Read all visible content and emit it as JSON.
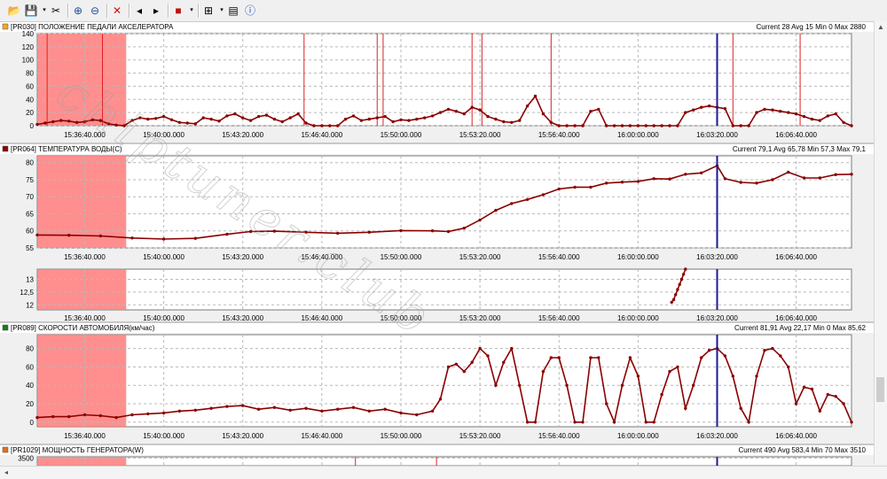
{
  "toolbar": {
    "buttons": [
      {
        "name": "open-icon",
        "glyph": "📂"
      },
      {
        "name": "save-icon",
        "glyph": "💾"
      },
      {
        "name": "save-dropdown-icon",
        "glyph": "▾",
        "small": true
      },
      {
        "name": "cut-icon",
        "glyph": "✂"
      },
      {
        "sep": true
      },
      {
        "name": "zoom-in-icon",
        "glyph": "⊕"
      },
      {
        "name": "zoom-out-icon",
        "glyph": "⊖"
      },
      {
        "sep": true
      },
      {
        "name": "delete-icon",
        "glyph": "✕"
      },
      {
        "sep": true
      },
      {
        "name": "previous-icon",
        "glyph": "◂"
      },
      {
        "name": "next-icon",
        "glyph": "▸"
      },
      {
        "sep": true
      },
      {
        "name": "color-icon",
        "glyph": "■"
      },
      {
        "name": "color-dropdown-icon",
        "glyph": "▾",
        "small": true
      },
      {
        "sep": true
      },
      {
        "name": "grid-icon",
        "glyph": "⊞"
      },
      {
        "name": "grid-dropdown-icon",
        "glyph": "▾",
        "small": true
      },
      {
        "name": "table-icon",
        "glyph": "▤"
      },
      {
        "name": "info-icon",
        "glyph": "ⓘ"
      }
    ]
  },
  "colors": {
    "trace": "#8b0000",
    "spike": "#e02020",
    "highlight": "#ff7b7b",
    "cursor": "#1a1a8c",
    "grid": "#b8b8b8",
    "plot_bg": "#ffffff",
    "header_bg": "#ffffff"
  },
  "time_ticks": [
    "15:36:40.000",
    "15:40:00.000",
    "15:43:20.000",
    "15:46:40.000",
    "15:50:00.000",
    "15:53:20.000",
    "15:56:40.000",
    "16:00:00.000",
    "16:03:20.000",
    "16:06:40.000"
  ],
  "highlight_range": [
    "15:34:40",
    "15:38:25"
  ],
  "cursor_time": "16:03:20",
  "watermark": "chiptuner.club",
  "chart_data": [
    {
      "type": "line",
      "id": "PR030",
      "header": "[PR030] ПОЛОЖЕНИЕ ПЕДАЛИ АКСЕЛЕРАТОРА",
      "stats": "Current 28 Avg 15 Min 0 Max 2880",
      "legend_color": "#f5a623",
      "ylim": [
        0,
        140
      ],
      "yticks": [
        "0",
        "20",
        "40",
        "60",
        "80",
        "100",
        "120",
        "140"
      ],
      "xlim": [
        "15:34:40",
        "16:09:00"
      ],
      "spikes": [
        "15:35:05",
        "15:37:25",
        "15:45:55",
        "15:49:00",
        "15:49:15",
        "15:53:00",
        "15:53:25",
        "15:56:20",
        "16:04:00",
        "16:06:50"
      ],
      "x": [
        "15:34:40",
        "15:35:00",
        "15:35:20",
        "15:35:40",
        "15:36:00",
        "15:36:20",
        "15:36:40",
        "15:37:00",
        "15:37:20",
        "15:37:40",
        "15:38:00",
        "15:38:20",
        "15:38:40",
        "15:39:00",
        "15:39:20",
        "15:39:40",
        "15:40:00",
        "15:40:20",
        "15:40:40",
        "15:41:00",
        "15:41:20",
        "15:41:40",
        "15:42:00",
        "15:42:20",
        "15:42:40",
        "15:43:00",
        "15:43:20",
        "15:43:40",
        "15:44:00",
        "15:44:20",
        "15:44:40",
        "15:45:00",
        "15:45:20",
        "15:45:40",
        "15:46:00",
        "15:46:20",
        "15:46:40",
        "15:47:00",
        "15:47:20",
        "15:47:40",
        "15:48:00",
        "15:48:20",
        "15:48:40",
        "15:49:00",
        "15:49:20",
        "15:49:40",
        "15:50:00",
        "15:50:20",
        "15:50:40",
        "15:51:00",
        "15:51:20",
        "15:51:40",
        "15:52:00",
        "15:52:20",
        "15:52:40",
        "15:53:00",
        "15:53:20",
        "15:53:40",
        "15:54:00",
        "15:54:20",
        "15:54:40",
        "15:55:00",
        "15:55:20",
        "15:55:40",
        "15:56:00",
        "15:56:20",
        "15:56:40",
        "15:57:00",
        "15:57:20",
        "15:57:40",
        "15:58:00",
        "15:58:20",
        "15:58:40",
        "15:59:00",
        "15:59:20",
        "15:59:40",
        "16:00:00",
        "16:00:20",
        "16:00:40",
        "16:01:00",
        "16:01:20",
        "16:01:40",
        "16:02:00",
        "16:02:20",
        "16:02:40",
        "16:03:00",
        "16:03:20",
        "16:03:40",
        "16:04:00",
        "16:04:20",
        "16:04:40",
        "16:05:00",
        "16:05:20",
        "16:05:40",
        "16:06:00",
        "16:06:20",
        "16:06:40",
        "16:07:00",
        "16:07:20",
        "16:07:40",
        "16:08:00",
        "16:08:20",
        "16:08:40",
        "16:09:00"
      ],
      "y": [
        2,
        4,
        6,
        8,
        7,
        5,
        6,
        9,
        8,
        3,
        1,
        0,
        8,
        12,
        10,
        11,
        14,
        9,
        5,
        4,
        3,
        12,
        10,
        7,
        15,
        18,
        12,
        8,
        14,
        16,
        10,
        6,
        12,
        18,
        4,
        0,
        0,
        0,
        0,
        10,
        15,
        8,
        10,
        12,
        14,
        6,
        9,
        8,
        10,
        12,
        15,
        20,
        25,
        22,
        18,
        28,
        24,
        14,
        10,
        6,
        5,
        8,
        30,
        45,
        18,
        5,
        0,
        0,
        0,
        0,
        22,
        25,
        0,
        0,
        0,
        0,
        0,
        0,
        0,
        0,
        0,
        0,
        20,
        24,
        28,
        30,
        28,
        26,
        0,
        0,
        0,
        20,
        25,
        24,
        22,
        20,
        18,
        14,
        10,
        8,
        15,
        18,
        5,
        0
      ]
    },
    {
      "type": "line",
      "id": "PR064",
      "header": "[PR064] ТЕМПЕРАТУРА ВОДЫ(C)",
      "stats": "Current 79,1 Avg 65,78 Min 57,3 Max 79,1",
      "legend_color": "#8b0000",
      "ylim": [
        55,
        82
      ],
      "yticks": [
        "55",
        "60",
        "65",
        "70",
        "75",
        "80"
      ],
      "xlim": [
        "15:34:40",
        "16:09:00"
      ],
      "x": [
        "15:34:40",
        "15:36:00",
        "15:37:20",
        "15:38:40",
        "15:40:00",
        "15:41:20",
        "15:42:40",
        "15:43:40",
        "15:44:40",
        "15:46:00",
        "15:47:20",
        "15:48:40",
        "15:50:00",
        "15:51:20",
        "15:52:00",
        "15:52:40",
        "15:53:20",
        "15:54:00",
        "15:54:40",
        "15:55:20",
        "15:56:00",
        "15:56:40",
        "15:57:20",
        "15:58:00",
        "15:58:40",
        "15:59:20",
        "16:00:00",
        "16:00:40",
        "16:01:20",
        "16:02:00",
        "16:02:40",
        "16:03:20",
        "16:03:40",
        "16:04:20",
        "16:05:00",
        "16:05:40",
        "16:06:20",
        "16:07:00",
        "16:07:40",
        "16:08:20",
        "16:09:00"
      ],
      "y": [
        58.8,
        58.7,
        58.5,
        57.9,
        57.6,
        57.8,
        59.0,
        59.8,
        59.9,
        59.6,
        59.3,
        59.6,
        60.1,
        60.0,
        59.8,
        60.8,
        63.2,
        66.0,
        68.0,
        69.2,
        70.6,
        72.3,
        72.8,
        72.8,
        74.0,
        74.3,
        74.5,
        75.3,
        75.2,
        76.6,
        77.0,
        79.1,
        75.3,
        74.2,
        74.0,
        75.0,
        77.2,
        75.5,
        75.5,
        76.5,
        76.6
      ]
    },
    {
      "type": "line",
      "id": "hidden-channel",
      "header": "",
      "stats": "",
      "legend_color": "",
      "ylim": [
        11.8,
        13.4
      ],
      "yticks": [
        "12",
        "12,5",
        "13"
      ],
      "xlim": [
        "15:34:40",
        "16:09:00"
      ],
      "x": [
        "16:01:25",
        "16:01:30",
        "16:01:35",
        "16:01:40",
        "16:01:45",
        "16:01:50",
        "16:01:55",
        "16:02:00"
      ],
      "y": [
        12.1,
        12.2,
        12.4,
        12.6,
        12.8,
        13.0,
        13.2,
        13.4
      ]
    },
    {
      "type": "line",
      "id": "PR089",
      "header": "[PR089] СКОРОСТИ АВТОМОБИЛЯ(км/час)",
      "stats": "Current 81,91 Avg 22,17 Min 0 Max 85,62",
      "legend_color": "#1a7a1a",
      "ylim": [
        -5,
        95
      ],
      "yticks": [
        "0",
        "20",
        "40",
        "60",
        "80"
      ],
      "xlim": [
        "15:34:40",
        "16:09:00"
      ],
      "x": [
        "15:34:40",
        "15:35:20",
        "15:36:00",
        "15:36:40",
        "15:37:20",
        "15:38:00",
        "15:38:40",
        "15:39:20",
        "15:40:00",
        "15:40:40",
        "15:41:20",
        "15:42:00",
        "15:42:40",
        "15:43:20",
        "15:44:00",
        "15:44:40",
        "15:45:20",
        "15:46:00",
        "15:46:40",
        "15:47:20",
        "15:48:00",
        "15:48:40",
        "15:49:20",
        "15:50:00",
        "15:50:40",
        "15:51:20",
        "15:51:40",
        "15:52:00",
        "15:52:20",
        "15:52:40",
        "15:53:00",
        "15:53:20",
        "15:53:40",
        "15:54:00",
        "15:54:20",
        "15:54:40",
        "15:55:00",
        "15:55:20",
        "15:55:40",
        "15:56:00",
        "15:56:20",
        "15:56:40",
        "15:57:00",
        "15:57:20",
        "15:57:40",
        "15:58:00",
        "15:58:20",
        "15:58:40",
        "15:59:00",
        "15:59:20",
        "15:59:40",
        "16:00:00",
        "16:00:20",
        "16:00:40",
        "16:01:00",
        "16:01:20",
        "16:01:40",
        "16:02:00",
        "16:02:20",
        "16:02:40",
        "16:03:00",
        "16:03:20",
        "16:03:40",
        "16:04:00",
        "16:04:20",
        "16:04:40",
        "16:05:00",
        "16:05:20",
        "16:05:40",
        "16:06:00",
        "16:06:20",
        "16:06:40",
        "16:07:00",
        "16:07:20",
        "16:07:40",
        "16:08:00",
        "16:08:20",
        "16:08:40",
        "16:09:00"
      ],
      "y": [
        5,
        6,
        6,
        8,
        7,
        5,
        8,
        9,
        10,
        12,
        13,
        15,
        17,
        18,
        14,
        16,
        13,
        15,
        12,
        14,
        16,
        12,
        14,
        10,
        8,
        12,
        25,
        60,
        63,
        55,
        65,
        80,
        72,
        40,
        65,
        80,
        40,
        0,
        0,
        55,
        70,
        70,
        40,
        0,
        0,
        70,
        70,
        20,
        0,
        40,
        70,
        50,
        0,
        0,
        30,
        55,
        60,
        15,
        40,
        70,
        78,
        80,
        72,
        50,
        15,
        0,
        50,
        78,
        80,
        72,
        60,
        20,
        38,
        36,
        12,
        30,
        28,
        20,
        0
      ]
    },
    {
      "type": "line",
      "id": "PR1029",
      "header": "[PR1029] МОЩНОСТЬ ГЕНЕРАТОРА(W)",
      "stats": "Current 490 Avg 583,4 Min 70 Max 3510",
      "legend_color": "#e07020",
      "ylim": [
        0,
        4000
      ],
      "yticks": [
        "3500"
      ],
      "xlim": [
        "15:34:40",
        "16:09:00"
      ],
      "spikes": [
        "15:48:05",
        "15:51:30"
      ],
      "x": [],
      "y": []
    }
  ]
}
